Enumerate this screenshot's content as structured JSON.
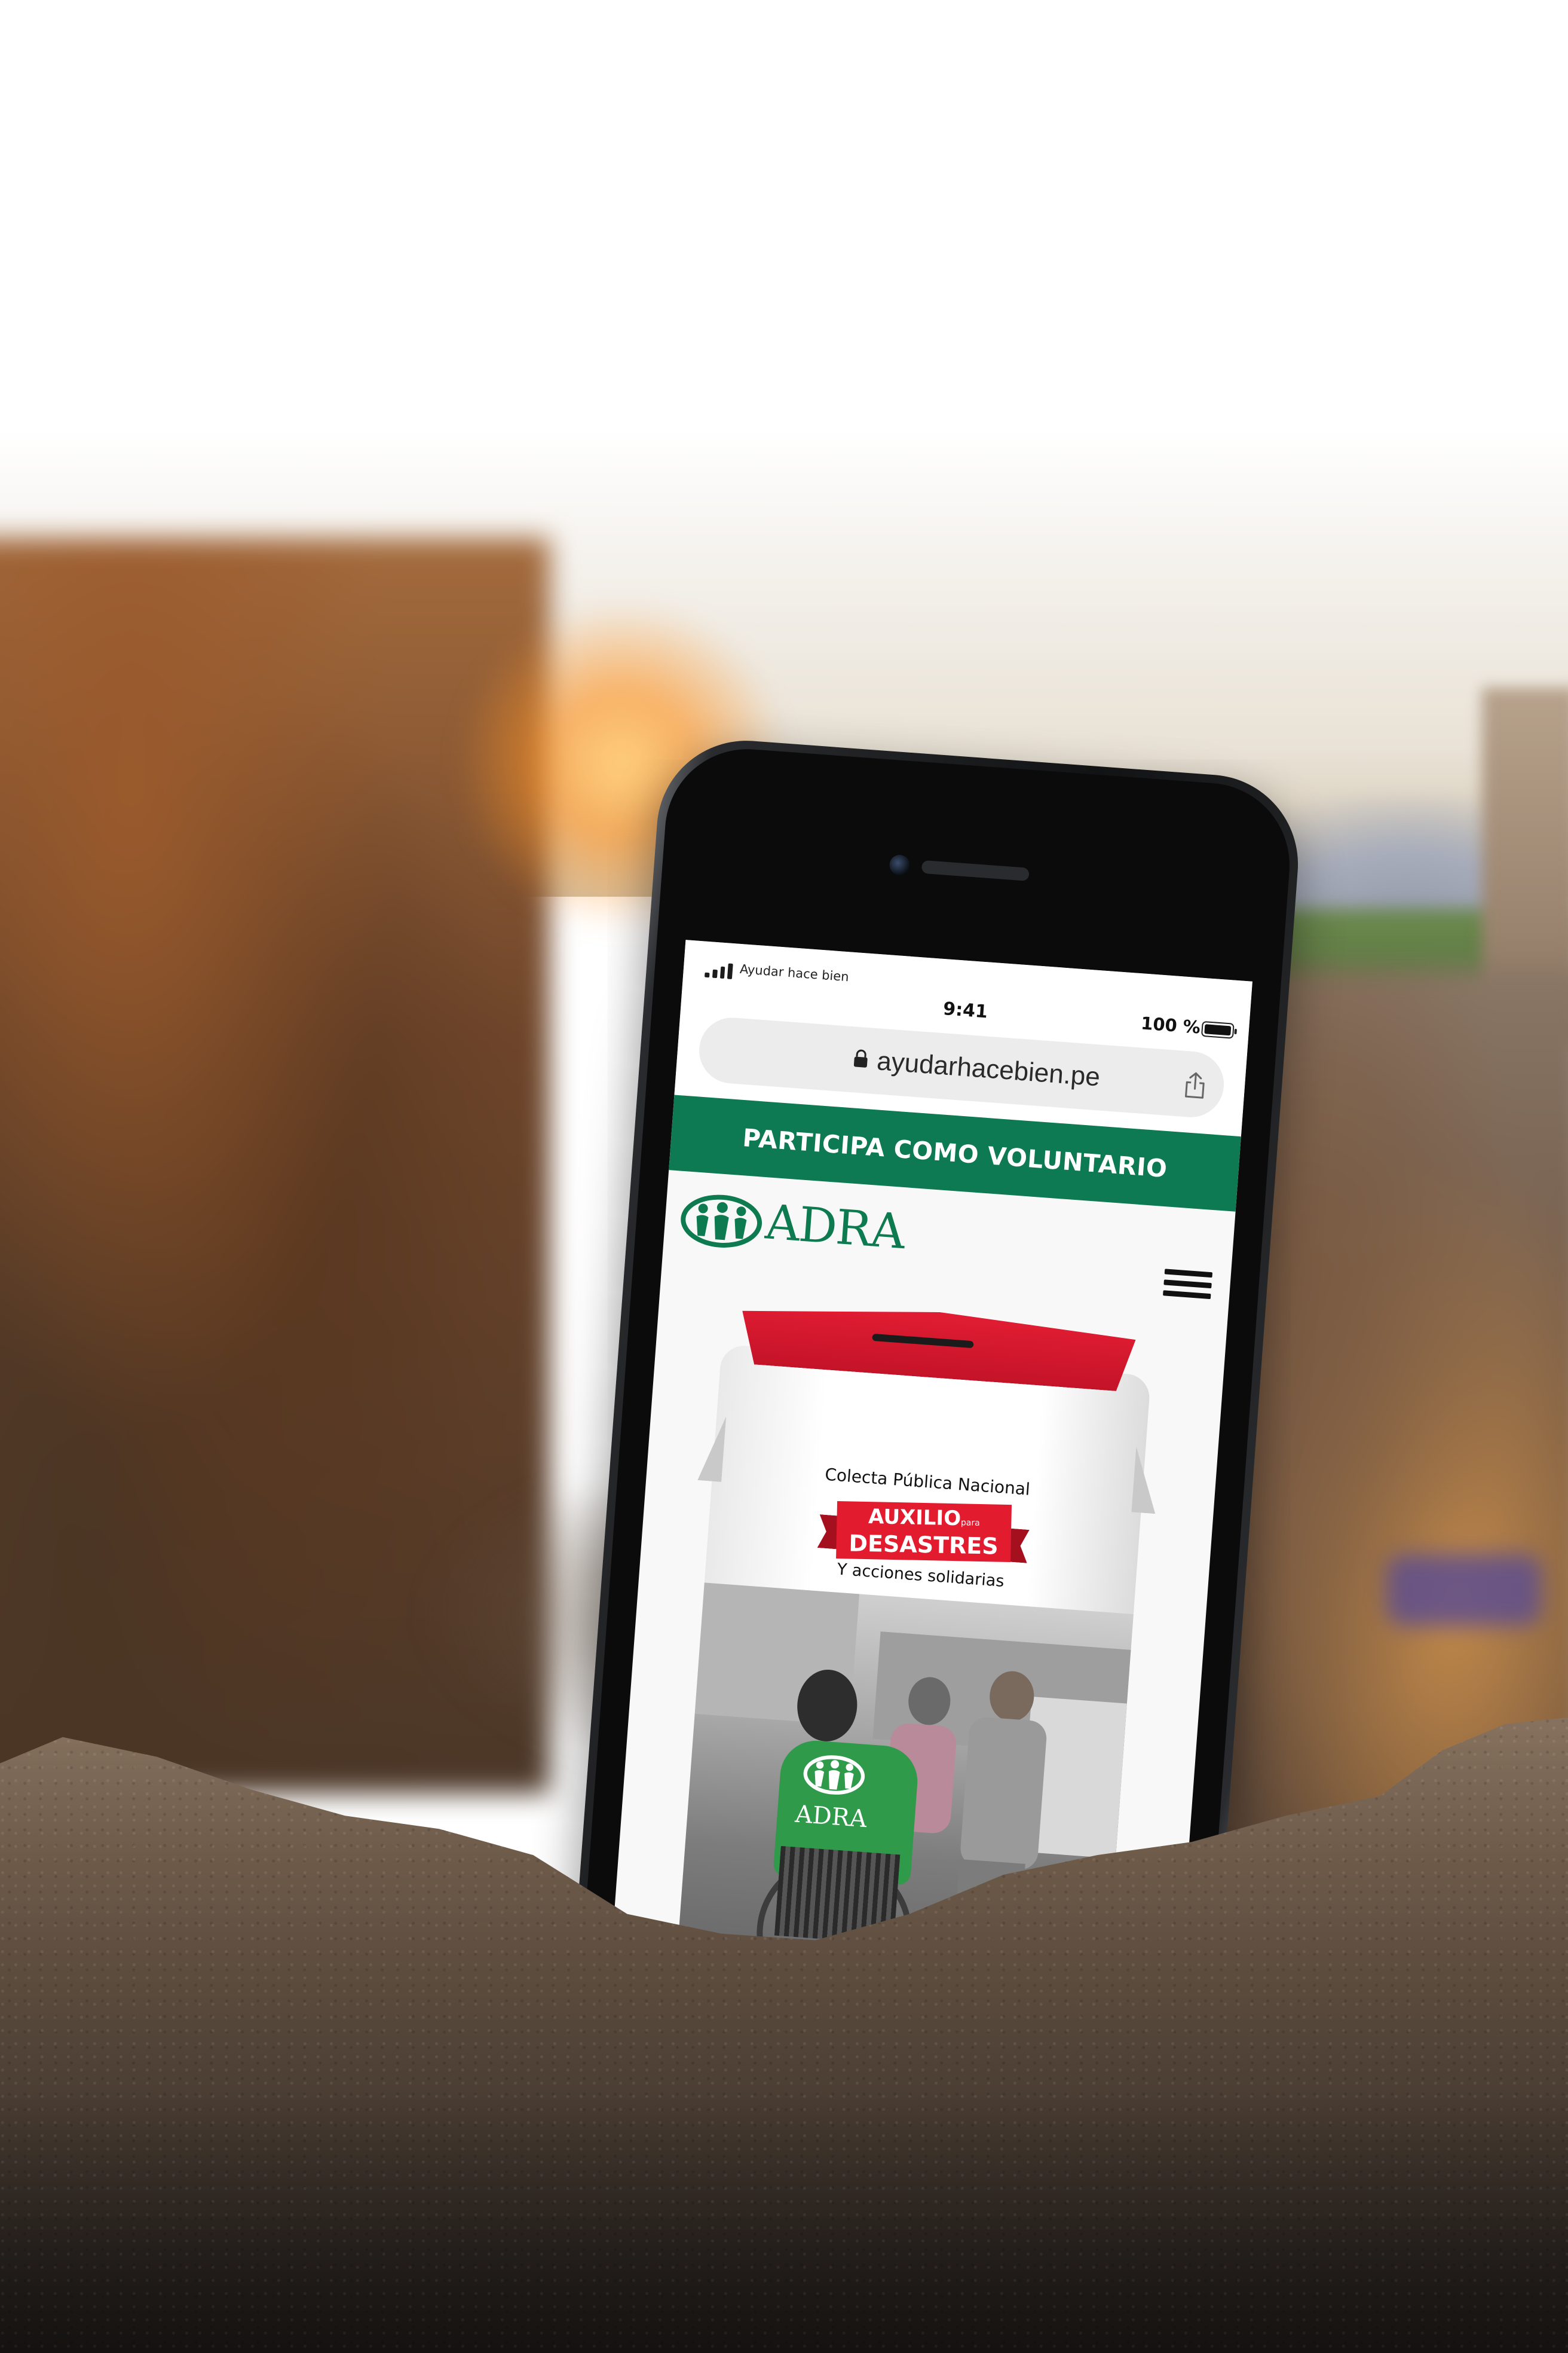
{
  "statusbar": {
    "carrier": "Ayudar hace bien",
    "time": "9:41",
    "battery": "100 %"
  },
  "browser": {
    "url": "ayudarhacebien.pe",
    "lock_icon": "lock-icon",
    "share_icon": "share-icon"
  },
  "banner": {
    "cta": "PARTICIPA COMO VOLUNTARIO",
    "color": "#0d7a53"
  },
  "header": {
    "logo_text": "ADRA",
    "logo_color": "#0e7a4f",
    "menu_icon": "hamburger-menu-icon"
  },
  "collection_box": {
    "line1": "Colecta Pública Nacional",
    "ribbon_word1": "AUXILIO",
    "ribbon_small": "para",
    "ribbon_word2": "DESASTRES",
    "line2": "Y acciones solidarias",
    "vest_text": "ADRA",
    "accent_color": "#e31b2f"
  }
}
